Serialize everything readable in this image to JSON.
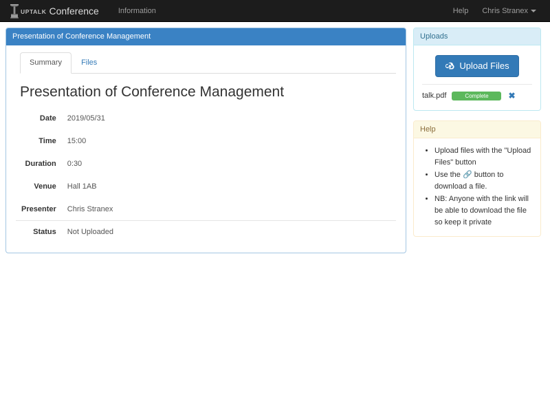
{
  "navbar": {
    "brand_mark": "UPTALK",
    "brand_name": "Conference",
    "logo_icon": "lectern-icon",
    "links": [
      {
        "label": "Information",
        "name": "nav-link-information"
      }
    ],
    "right_links": [
      {
        "label": "Help",
        "name": "nav-link-help"
      }
    ],
    "user": "Chris Stranex"
  },
  "main_panel": {
    "heading": "Presentation of Conference Management",
    "tabs": [
      {
        "label": "Summary",
        "active": true
      },
      {
        "label": "Files",
        "active": false
      }
    ],
    "title": "Presentation of Conference Management",
    "details": [
      {
        "label": "Date",
        "value": "2019/05/31"
      },
      {
        "label": "Time",
        "value": "15:00"
      },
      {
        "label": "Duration",
        "value": "0:30"
      },
      {
        "label": "Venue",
        "value": "Hall 1AB"
      },
      {
        "label": "Presenter",
        "value": "Chris Stranex"
      },
      {
        "label": "Status",
        "value": "Not Uploaded"
      }
    ]
  },
  "uploads_panel": {
    "heading": "Uploads",
    "upload_button_label": "Upload Files",
    "upload_icon": "cloud-upload-icon",
    "files": [
      {
        "name": "talk.pdf",
        "progress_label": "Complete",
        "progress_percent": 100,
        "remove_label": "✖"
      }
    ]
  },
  "help_panel": {
    "heading": "Help",
    "items": [
      "Upload files with the \"Upload Files\" button",
      "Use the 🔗 button to download a file.",
      "NB: Anyone with the link will be able to download the file so keep it private"
    ]
  },
  "colors": {
    "navbar_bg": "#1c1c1c",
    "panel_primary": "#3a82c4",
    "btn_primary": "#337ab7",
    "progress_success": "#5cb85c",
    "panel_info_bg": "#d9edf7",
    "panel_warning_bg": "#fcf8e3"
  }
}
